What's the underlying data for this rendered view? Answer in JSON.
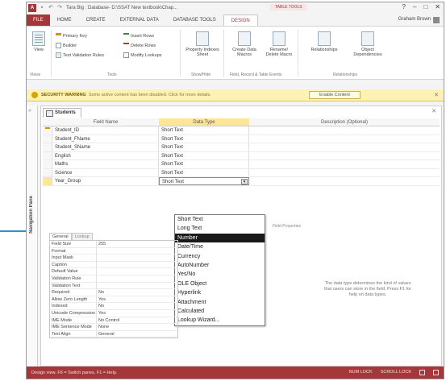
{
  "window": {
    "title": "Tara Big : Database- D:\\SSAT New textbook\\Chap...",
    "context_label": "TABLE TOOLS",
    "controls": [
      "?",
      "–",
      "□",
      "✕"
    ]
  },
  "tabs": [
    "FILE",
    "HOME",
    "CREATE",
    "EXTERNAL DATA",
    "DATABASE TOOLS",
    "DESIGN"
  ],
  "user": "Graham Brown",
  "ribbon": {
    "view": "View",
    "primary_key": "Primary Key",
    "builder": "Builder",
    "test_validation": "Test Validation Rules",
    "insert_rows": "Insert Rows",
    "delete_rows": "Delete Rows",
    "modify_lookups": "Modify Lookups",
    "property_sheet": "Property Indexes Sheet",
    "create_data_macros": "Create Data Macros",
    "rename_delete_macro": "Rename/ Delete Macro",
    "relationships": "Relationships",
    "object_dependencies": "Object Dependencies",
    "groups": [
      "Views",
      "Tools",
      "Show/Hide",
      "Field, Record & Table Events",
      "Relationships"
    ]
  },
  "security": {
    "title": "SECURITY WARNING",
    "message": "Some active content has been disabled. Click for more details.",
    "button": "Enable Content"
  },
  "nav_pane_label": "Navigation Pane",
  "doc_tab": "Students",
  "table": {
    "headers": [
      "Field Name",
      "Data Type",
      "Description (Optional)"
    ],
    "rows": [
      {
        "field": "Student_ID",
        "type": "Short Text",
        "key": true
      },
      {
        "field": "Student_FName",
        "type": "Short Text"
      },
      {
        "field": "Student_SName",
        "type": "Short Text"
      },
      {
        "field": "English",
        "type": "Short Text"
      },
      {
        "field": "Maths",
        "type": "Short Text"
      },
      {
        "field": "Science",
        "type": "Short Text"
      },
      {
        "field": "Year_Group",
        "type": "Short Text",
        "active": true
      }
    ]
  },
  "dropdown": {
    "options": [
      "Short Text",
      "Long Text",
      "Number",
      "Date/Time",
      "Currency",
      "AutoNumber",
      "Yes/No",
      "OLE Object",
      "Hyperlink",
      "Attachment",
      "Calculated",
      "Lookup Wizard..."
    ],
    "selected": "Number"
  },
  "field_properties": {
    "caption": "Field Properties",
    "tabs": [
      "General",
      "Lookup"
    ],
    "rows": [
      {
        "name": "Field Size",
        "value": "255"
      },
      {
        "name": "Format",
        "value": ""
      },
      {
        "name": "Input Mask",
        "value": ""
      },
      {
        "name": "Caption",
        "value": ""
      },
      {
        "name": "Default Value",
        "value": ""
      },
      {
        "name": "Validation Rule",
        "value": ""
      },
      {
        "name": "Validation Text",
        "value": ""
      },
      {
        "name": "Required",
        "value": "No"
      },
      {
        "name": "Allow Zero Length",
        "value": "Yes"
      },
      {
        "name": "Indexed",
        "value": "No"
      },
      {
        "name": "Unicode Compression",
        "value": "Yes"
      },
      {
        "name": "IME Mode",
        "value": "No Control"
      },
      {
        "name": "IME Sentence Mode",
        "value": "None"
      },
      {
        "name": "Text Align",
        "value": "General"
      }
    ]
  },
  "help_text": "The data type determines the kind of values that users can store in the field. Press F1 for help on data types.",
  "status": {
    "left": "Design view. F6 = Switch panes. F1 = Help.",
    "num_lock": "NUM LOCK",
    "scroll_lock": "SCROLL LOCK"
  },
  "colors": {
    "accent": "#a4373a",
    "callout": "#2a93d5",
    "highlight": "#ffe697",
    "selected": "#1a1a1a"
  }
}
